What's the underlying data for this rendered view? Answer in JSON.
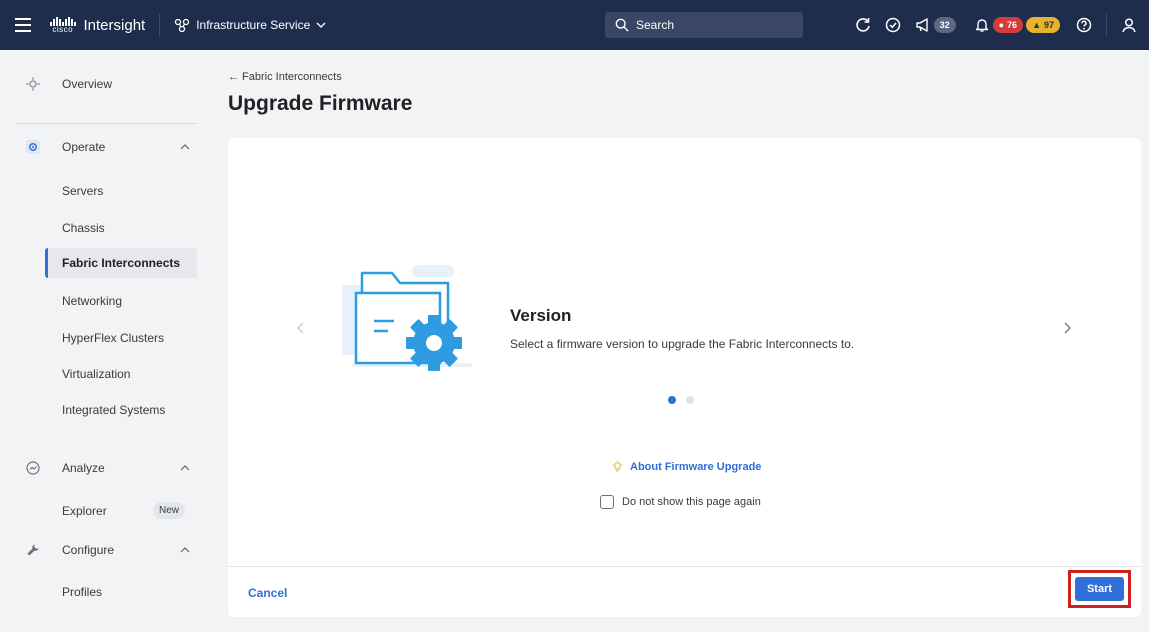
{
  "topbar": {
    "logo_text": "cisco",
    "app_name": "Intersight",
    "service": "Infrastructure Service",
    "search_placeholder": "Search",
    "announcements_count": "32",
    "alarms_critical": "76",
    "alarms_warning": "97"
  },
  "sidebar": {
    "overview": "Overview",
    "operate": "Operate",
    "operate_items": [
      "Servers",
      "Chassis",
      "Fabric Interconnects",
      "Networking",
      "HyperFlex Clusters",
      "Virtualization",
      "Integrated Systems"
    ],
    "active_item": "Fabric Interconnects",
    "analyze": "Analyze",
    "explorer": "Explorer",
    "explorer_badge": "New",
    "configure": "Configure",
    "profiles": "Profiles"
  },
  "main": {
    "breadcrumb": "← Fabric Interconnects",
    "title": "Upgrade Firmware",
    "step_title": "Version",
    "step_description": "Select a firmware version to upgrade the Fabric Interconnects to.",
    "about_link": "About Firmware Upgrade",
    "checkbox_label": "Do not show this page again",
    "cancel_label": "Cancel",
    "start_label": "Start",
    "current_step": 1,
    "total_steps": 2
  },
  "colors": {
    "topbar": "#1f2d4d",
    "accent": "#2f6fd7",
    "critical": "#d63b3b",
    "warning": "#e7b32a",
    "highlight_box": "#d01f1f"
  }
}
